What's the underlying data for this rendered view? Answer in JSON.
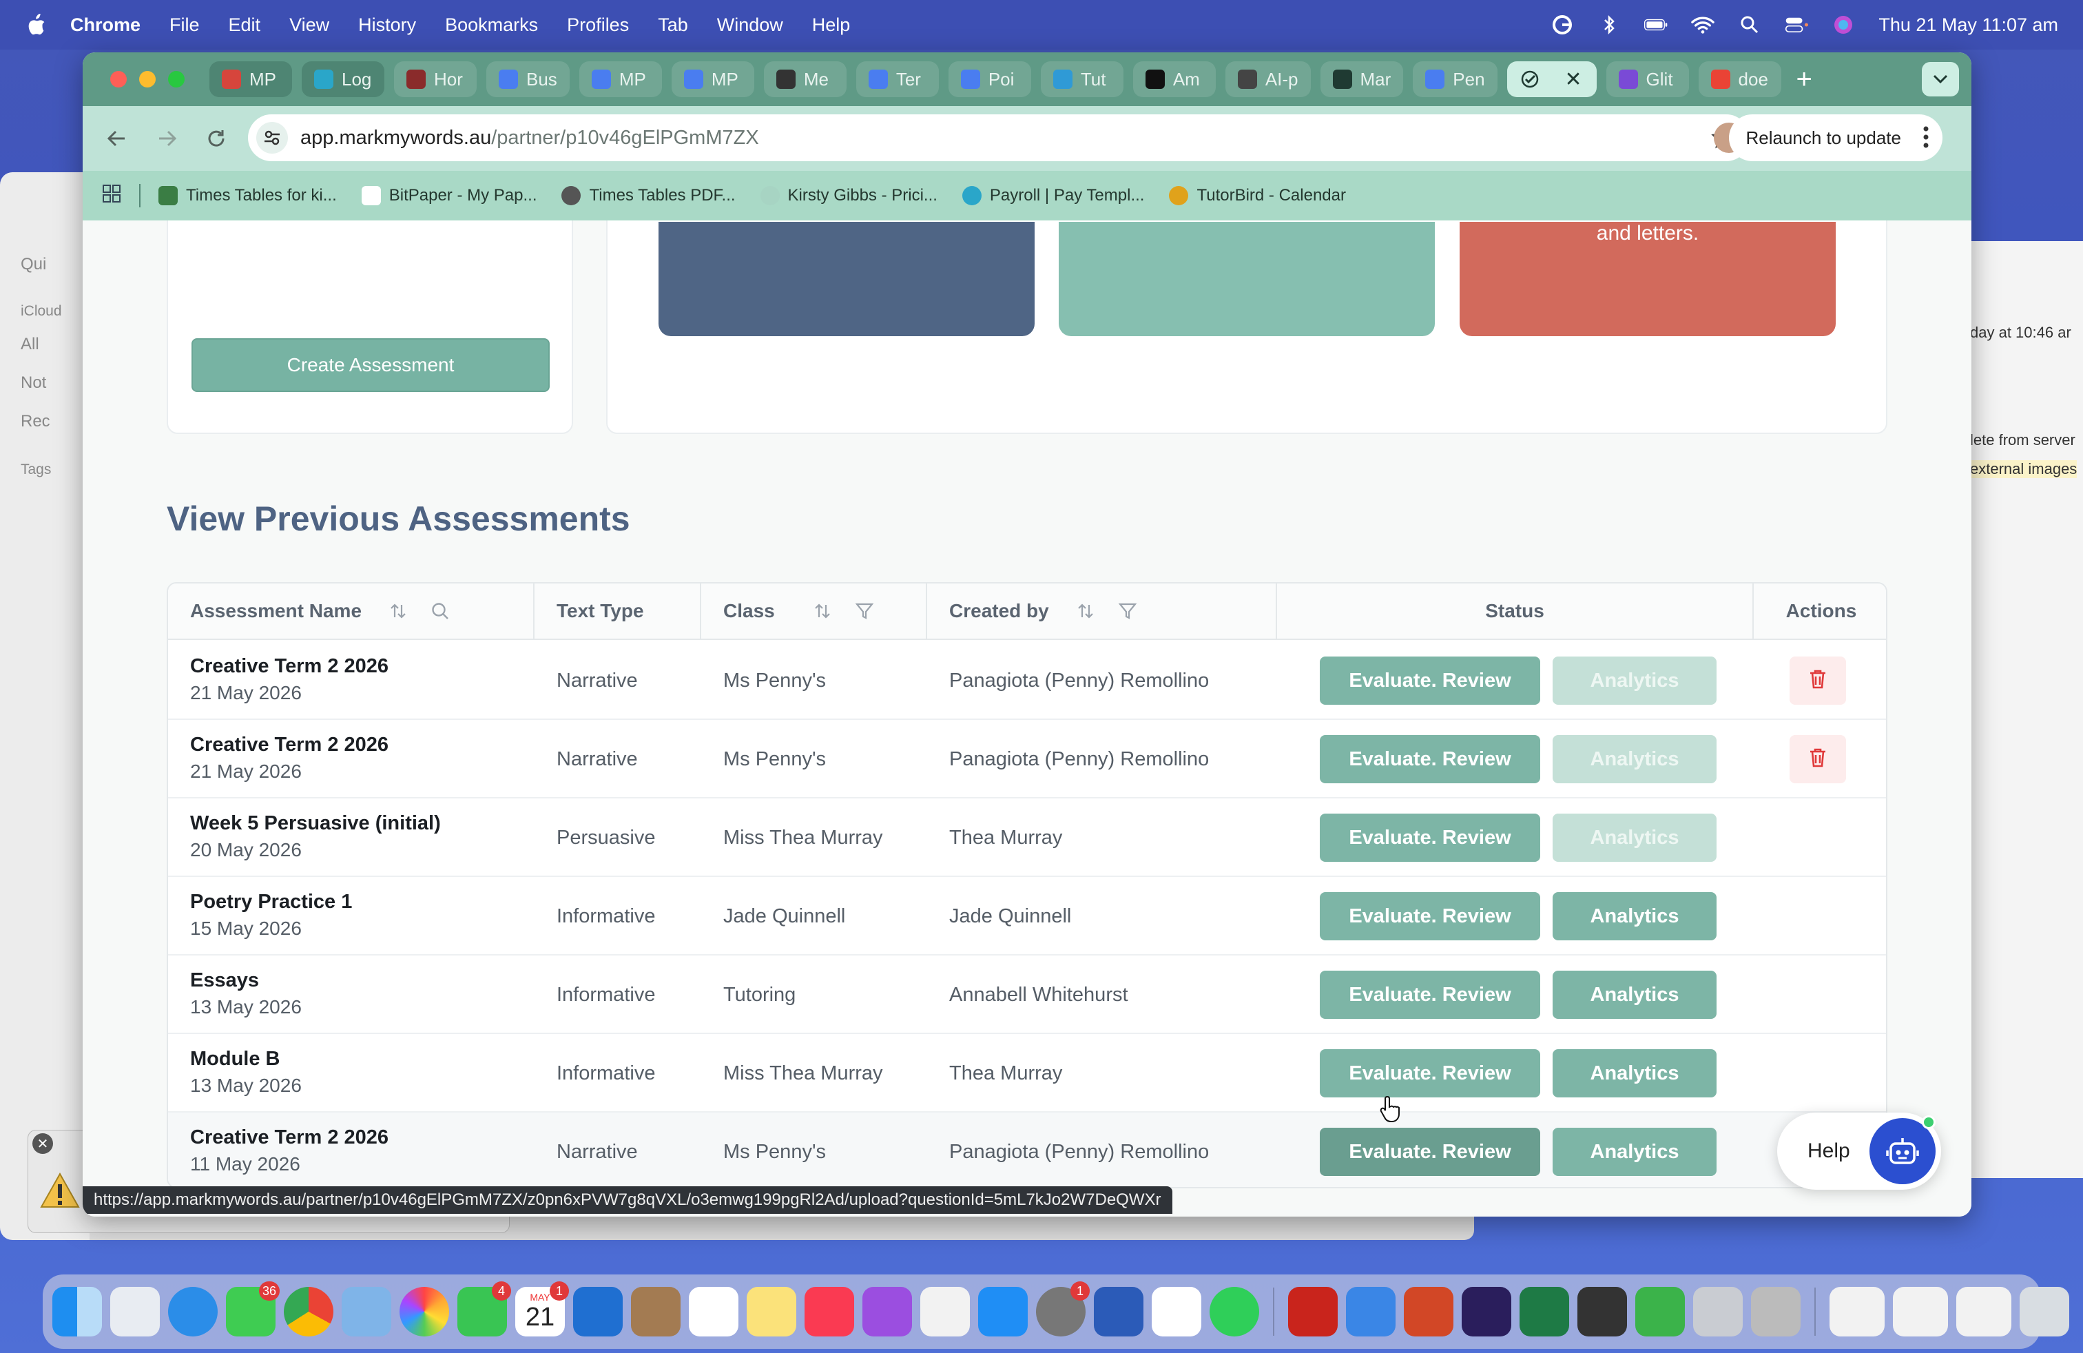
{
  "menubar": {
    "app": "Chrome",
    "items": [
      "File",
      "Edit",
      "View",
      "History",
      "Bookmarks",
      "Profiles",
      "Tab",
      "Window",
      "Help"
    ],
    "datetime": "Thu 21 May  11:07 am"
  },
  "bg_window_left": {
    "labels": [
      "Qui",
      "iCloud",
      "All",
      "Not",
      "Rec",
      "Tags"
    ]
  },
  "bg_window_right": {
    "labels": [
      "day at 10:46 ar",
      "lete from server",
      "external images"
    ]
  },
  "tabs": [
    {
      "label": "MP",
      "color": "#d6453c"
    },
    {
      "label": "Log",
      "color": "#2aa6c9"
    },
    {
      "label": "Hor",
      "color": "#8a2b2b"
    },
    {
      "label": "Bus",
      "color": "#4a7df0"
    },
    {
      "label": "MP",
      "color": "#4a7df0"
    },
    {
      "label": "MP",
      "color": "#4a7df0"
    },
    {
      "label": "Me",
      "color": "#333333"
    },
    {
      "label": "Ter",
      "color": "#4a7df0"
    },
    {
      "label": "Poi",
      "color": "#4a7df0"
    },
    {
      "label": "Tut",
      "color": "#2f9ad6"
    },
    {
      "label": "Am",
      "color": "#111111"
    },
    {
      "label": "AI-p",
      "color": "#444444"
    },
    {
      "label": "Mar",
      "color": "#1f3a32"
    },
    {
      "label": "Pen",
      "color": "#4a7df0"
    },
    {
      "label": "",
      "color": "#1f3a32"
    },
    {
      "label": "Glit",
      "color": "#7a4ad6"
    },
    {
      "label": "doe",
      "color": "#ea4335"
    }
  ],
  "address": {
    "host": "app.markmywords.au",
    "path": "/partner/p10v46gElPGmM7ZX"
  },
  "relaunch_label": "Relaunch to update",
  "bookmarks": [
    {
      "label": "Times Tables for ki...",
      "color": "#3a7d44"
    },
    {
      "label": "BitPaper - My Pap...",
      "color": "#ffffff"
    },
    {
      "label": "Times Tables PDF...",
      "color": "#555555"
    },
    {
      "label": "Kirsty Gibbs - Prici...",
      "color": "#a7d4c3"
    },
    {
      "label": "Payroll | Pay Templ...",
      "color": "#2aa6c9"
    },
    {
      "label": "TutorBird - Calendar",
      "color": "#e0a21b"
    }
  ],
  "page": {
    "create_button": "Create Assessment",
    "tile_text": "and letters.",
    "section_title": "View Previous Assessments",
    "columns": [
      "Assessment Name",
      "Text Type",
      "Class",
      "Created by",
      "Status",
      "Actions"
    ],
    "eval_label": "Evaluate. Review",
    "analytics_label": "Analytics",
    "rows": [
      {
        "name": "Creative Term 2 2026",
        "date": "21 May 2026",
        "type": "Narrative",
        "class": "Ms Penny's",
        "creator": "Panagiota (Penny) Remollino",
        "analytics": false,
        "delete": true
      },
      {
        "name": "Creative Term 2 2026",
        "date": "21 May 2026",
        "type": "Narrative",
        "class": "Ms Penny's",
        "creator": "Panagiota (Penny) Remollino",
        "analytics": false,
        "delete": true
      },
      {
        "name": "Week 5 Persuasive (initial)",
        "date": "20 May 2026",
        "type": "Persuasive",
        "class": "Miss Thea Murray",
        "creator": "Thea Murray",
        "analytics": false,
        "delete": false
      },
      {
        "name": "Poetry Practice 1",
        "date": "15 May 2026",
        "type": "Informative",
        "class": "Jade Quinnell",
        "creator": "Jade Quinnell",
        "analytics": true,
        "delete": false
      },
      {
        "name": "Essays",
        "date": "13 May 2026",
        "type": "Informative",
        "class": "Tutoring",
        "creator": "Annabell Whitehurst",
        "analytics": true,
        "delete": false
      },
      {
        "name": "Module B",
        "date": "13 May 2026",
        "type": "Informative",
        "class": "Miss Thea Murray",
        "creator": "Thea Murray",
        "analytics": true,
        "delete": false
      },
      {
        "name": "Creative Term 2 2026",
        "date": "11 May 2026",
        "type": "Narrative",
        "class": "Ms Penny's",
        "creator": "Panagiota (Penny) Remollino",
        "analytics": true,
        "delete": true
      }
    ],
    "help_label": "Help"
  },
  "status_url": "https://app.markmywords.au/partner/p10v46gElPGmM7ZX/z0pn6xPVW7g8qVXL/o3emwg199pgRl2Ad/upload?questionId=5mL7kJo2W7DeQWXr",
  "dock": {
    "badges": {
      "messages": "36",
      "facetime": "4",
      "calendar": "1",
      "settings": "1"
    },
    "calendar_month": "MAY",
    "calendar_day": "21"
  },
  "colors": {
    "accent": "#7db5a6",
    "tab_bar": "#5f9a86",
    "title": "#4e6383",
    "tile_blue": "#4f6585",
    "tile_teal": "#86bfb0",
    "tile_red": "#d26a5c",
    "delete_red": "#e0393a"
  }
}
